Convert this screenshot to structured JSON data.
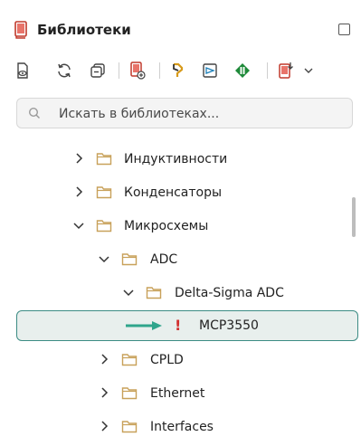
{
  "header": {
    "title": "Библиотеки"
  },
  "toolbar": {
    "icons": [
      "eye-doc-icon",
      "refresh-icon",
      "collapse-all-icon",
      "add-library-icon",
      "component-icon",
      "symbol-icon",
      "footprint-icon",
      "import-icon"
    ]
  },
  "search": {
    "placeholder": "Искать в библиотеках..."
  },
  "tree": {
    "items": [
      {
        "label": "Индуктивности",
        "expanded": false,
        "type": "folder"
      },
      {
        "label": "Конденсаторы",
        "expanded": false,
        "type": "folder"
      },
      {
        "label": "Микросхемы",
        "expanded": true,
        "type": "folder"
      },
      {
        "label": "ADC",
        "expanded": true,
        "type": "folder"
      },
      {
        "label": "Delta-Sigma ADC",
        "expanded": true,
        "type": "folder"
      },
      {
        "label": "MCP3550",
        "type": "component",
        "selected": true,
        "warning": "!"
      },
      {
        "label": "CPLD",
        "expanded": false,
        "type": "folder"
      },
      {
        "label": "Ethernet",
        "expanded": false,
        "type": "folder"
      },
      {
        "label": "Interfaces",
        "expanded": false,
        "type": "folder"
      }
    ]
  },
  "colors": {
    "accent": "#3c8c84",
    "folder": "#c8a15a",
    "warning": "#d23030",
    "arrow": "#2fa58c",
    "library_red": "#c0392b",
    "footprint_green": "#1f8a3a"
  }
}
